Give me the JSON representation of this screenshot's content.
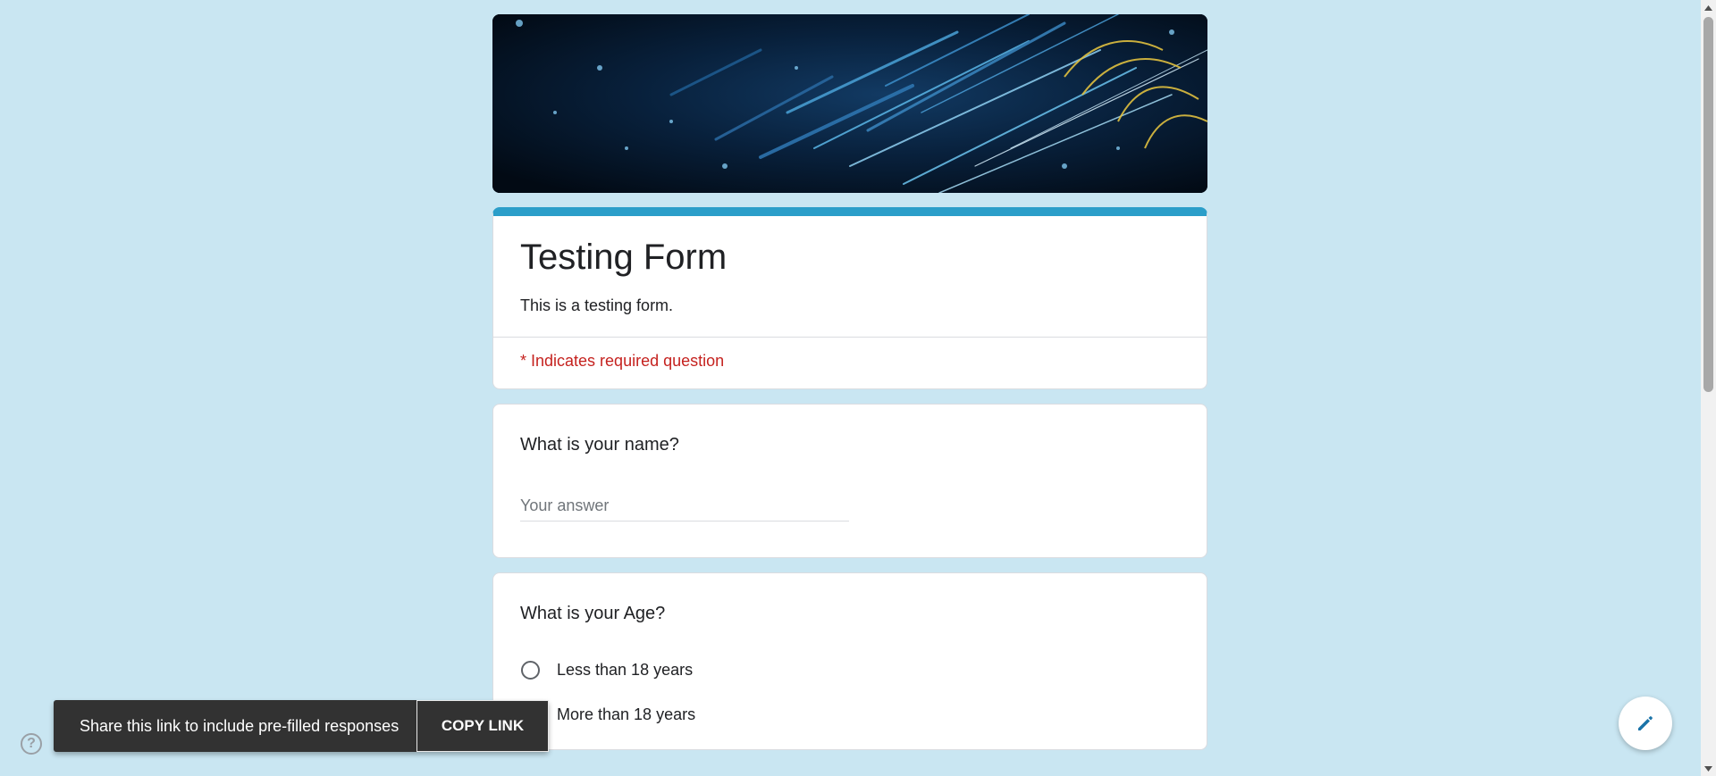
{
  "form": {
    "title": "Testing Form",
    "description": "This is a testing form.",
    "required_note": "* Indicates required question"
  },
  "questions": [
    {
      "title": "What is your name?",
      "type": "short-answer",
      "placeholder": "Your answer"
    },
    {
      "title": "What is your Age?",
      "type": "multiple-choice",
      "options": [
        "Less than 18 years",
        "More than 18 years"
      ]
    }
  ],
  "snackbar": {
    "message": "Share this link to include pre-filled responses",
    "action_label": "COPY LINK"
  },
  "icons": {
    "help": "help-icon",
    "edit": "pencil-icon"
  },
  "colors": {
    "page_background": "#c9e6f2",
    "accent": "#2b9ec9",
    "required": "#c5221f"
  }
}
